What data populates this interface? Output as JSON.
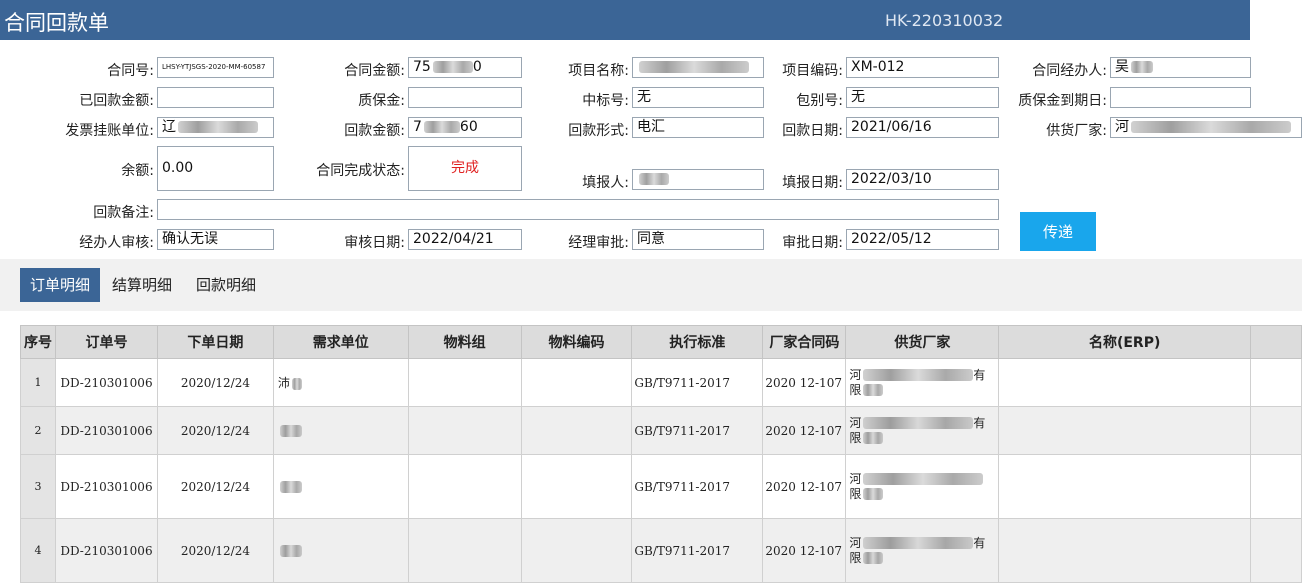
{
  "header": {
    "title": "合同回款单",
    "doc_no": "HK-220310032"
  },
  "form": {
    "contract_no": {
      "label": "合同号:",
      "value": "LHSY-YTJSGS-2020-MM-60587"
    },
    "contract_amount": {
      "label": "合同金额:",
      "value_start": "75",
      "value_end": "0"
    },
    "project_name": {
      "label": "项目名称:",
      "value": ""
    },
    "project_code": {
      "label": "项目编码:",
      "value": "XM-012"
    },
    "contract_manager": {
      "label": "合同经办人:",
      "value": "吴"
    },
    "received_amount": {
      "label": "已回款金额:",
      "value": ""
    },
    "warranty_amount": {
      "label": "质保金:",
      "value": ""
    },
    "bid_no": {
      "label": "中标号:",
      "value": "无"
    },
    "package_no": {
      "label": "包别号:",
      "value": "无"
    },
    "warranty_due": {
      "label": "质保金到期日:",
      "value": ""
    },
    "invoice_unit": {
      "label": "发票挂账单位:",
      "value": "辽"
    },
    "payment_amount": {
      "label": "回款金额:",
      "value_start": "7",
      "value_end": "60"
    },
    "payment_form": {
      "label": "回款形式:",
      "value": "电汇"
    },
    "payment_date": {
      "label": "回款日期:",
      "value": "2021/06/16"
    },
    "supplier": {
      "label": "供货厂家:",
      "value": "河"
    },
    "balance": {
      "label": "余额:",
      "value": "0.00"
    },
    "completion_status": {
      "label": "合同完成状态:",
      "value": "完成"
    },
    "reporter": {
      "label": "填报人:",
      "value": ""
    },
    "report_date": {
      "label": "填报日期:",
      "value": "2022/03/10"
    },
    "remark": {
      "label": "回款备注:",
      "value": ""
    },
    "manager_review": {
      "label": "经办人审核:",
      "value": "确认无误"
    },
    "review_date": {
      "label": "审核日期:",
      "value": "2022/04/21"
    },
    "director_approval": {
      "label": "经理审批:",
      "value": "同意"
    },
    "approval_date": {
      "label": "审批日期:",
      "value": "2022/05/12"
    }
  },
  "send_button": "传递",
  "tabs": [
    {
      "label": "订单明细",
      "active": true
    },
    {
      "label": "结算明细",
      "active": false
    },
    {
      "label": "回款明细",
      "active": false
    }
  ],
  "table": {
    "columns": [
      "序号",
      "订单号",
      "下单日期",
      "需求单位",
      "物料组",
      "物料编码",
      "执行标准",
      "厂家合同码",
      "供货厂家",
      "名称(ERP)"
    ],
    "rows": [
      {
        "idx": "1",
        "order_no": "DD-210301006",
        "date": "2020/12/24",
        "unit": "沛",
        "group": "",
        "code": "",
        "standard": "GB/T9711-2017",
        "mfr_code": "2020 12-107",
        "sup_1": "河",
        "sup_1_end": "有",
        "sup_2": "限",
        "erp": ""
      },
      {
        "idx": "2",
        "order_no": "DD-210301006",
        "date": "2020/12/24",
        "unit": "",
        "group": "",
        "code": "",
        "standard": "GB/T9711-2017",
        "mfr_code": "2020 12-107",
        "sup_1": "河",
        "sup_1_end": "有",
        "sup_2": "限",
        "erp": ""
      },
      {
        "idx": "3",
        "order_no": "DD-210301006",
        "date": "2020/12/24",
        "unit": "",
        "group": "",
        "code": "",
        "standard": "GB/T9711-2017",
        "mfr_code": "2020 12-107",
        "sup_1": "河",
        "sup_1_end": "",
        "sup_2": "限",
        "erp": ""
      },
      {
        "idx": "4",
        "order_no": "DD-210301006",
        "date": "2020/12/24",
        "unit": "",
        "group": "",
        "code": "",
        "standard": "GB/T9711-2017",
        "mfr_code": "2020 12-107",
        "sup_1": "河",
        "sup_1_end": "有",
        "sup_2": "限",
        "erp": ""
      }
    ]
  },
  "colors": {
    "header_bg": "#3b6596",
    "accent_button": "#19a6ec",
    "status_done": "#e02020"
  }
}
